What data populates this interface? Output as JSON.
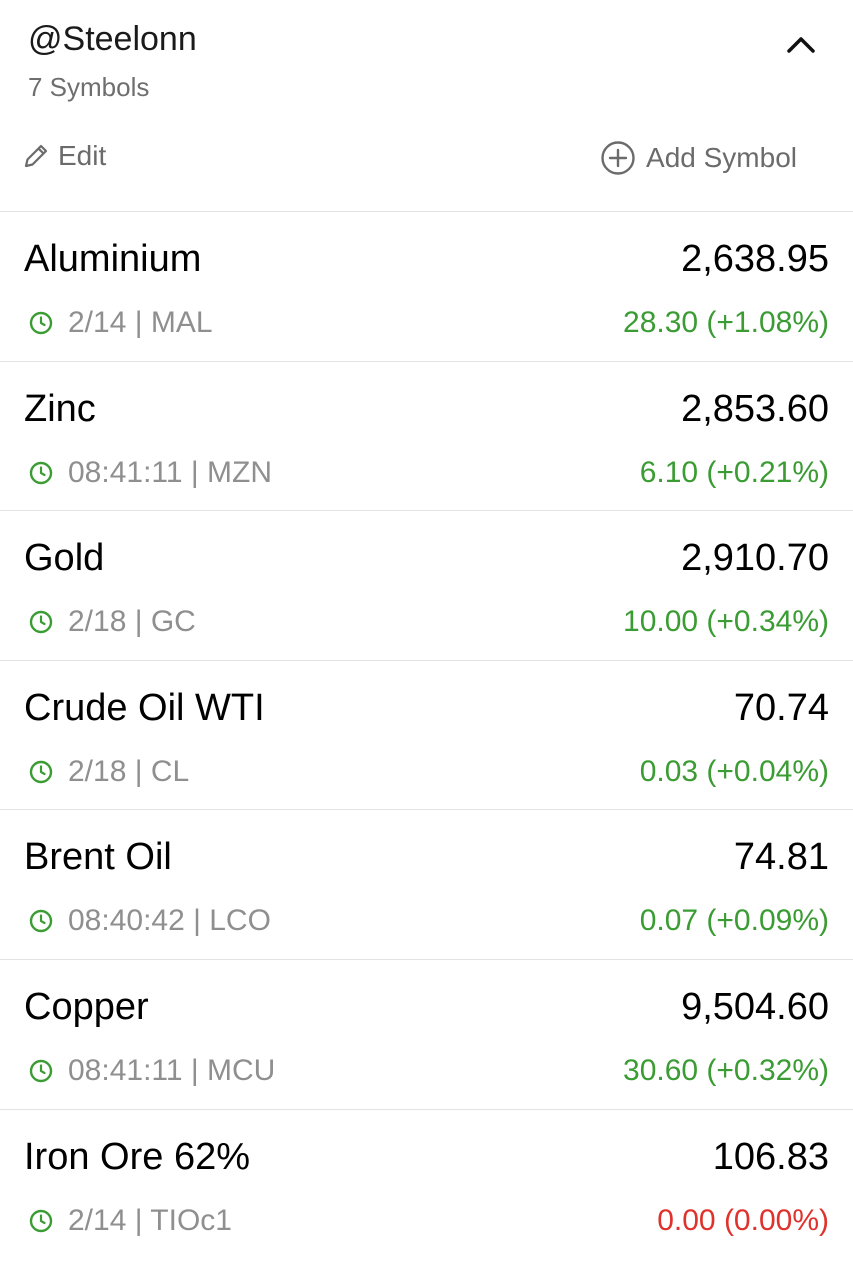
{
  "header": {
    "watchlist_name": "@Steelonn",
    "symbol_count": "7 Symbols",
    "edit_label": "Edit",
    "add_label": "Add Symbol"
  },
  "colors": {
    "positive": "#3a9c33",
    "zero": "#e0322c",
    "muted": "#8f8f8f",
    "clock_icon": "#3a9c33"
  },
  "icons": {
    "collapse": "chevron-up-icon",
    "edit": "pencil-icon",
    "add": "plus-circle-icon",
    "time": "clock-icon"
  },
  "rows": [
    {
      "name": "Aluminium",
      "price": "2,638.95",
      "meta": "2/14 | MAL",
      "change": "28.30 (+1.08%)",
      "trend": "up"
    },
    {
      "name": "Zinc",
      "price": "2,853.60",
      "meta": "08:41:11 | MZN",
      "change": "6.10 (+0.21%)",
      "trend": "up"
    },
    {
      "name": "Gold",
      "price": "2,910.70",
      "meta": "2/18 | GC",
      "change": "10.00 (+0.34%)",
      "trend": "up"
    },
    {
      "name": "Crude Oil WTI",
      "price": "70.74",
      "meta": "2/18 | CL",
      "change": "0.03 (+0.04%)",
      "trend": "up"
    },
    {
      "name": "Brent Oil",
      "price": "74.81",
      "meta": "08:40:42 | LCO",
      "change": "0.07 (+0.09%)",
      "trend": "up"
    },
    {
      "name": "Copper",
      "price": "9,504.60",
      "meta": "08:41:11 | MCU",
      "change": "30.60 (+0.32%)",
      "trend": "up"
    },
    {
      "name": "Iron Ore 62%",
      "price": "106.83",
      "meta": "2/14 | TIOc1",
      "change": "0.00 (0.00%)",
      "trend": "flat"
    }
  ]
}
